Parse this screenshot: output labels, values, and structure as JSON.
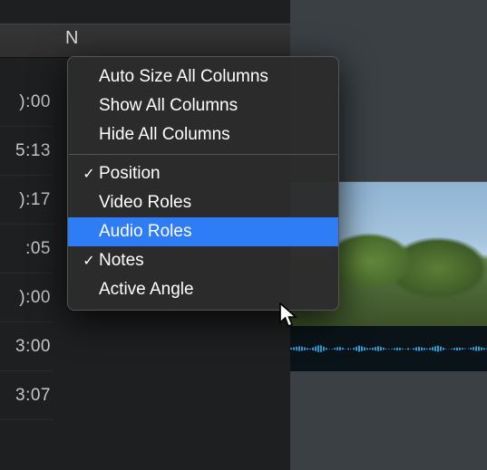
{
  "header": {
    "letter": "N"
  },
  "timecodes": [
    "):00",
    "5:13",
    "):17",
    ":05",
    "):00",
    "3:00",
    "3:07"
  ],
  "menu": {
    "top": [
      {
        "label": "Auto Size All Columns"
      },
      {
        "label": "Show All Columns"
      },
      {
        "label": "Hide All Columns"
      }
    ],
    "columns": [
      {
        "label": "Position",
        "checked": true,
        "highlight": false
      },
      {
        "label": "Video Roles",
        "checked": false,
        "highlight": false
      },
      {
        "label": "Audio Roles",
        "checked": false,
        "highlight": true
      },
      {
        "label": "Notes",
        "checked": true,
        "highlight": false
      },
      {
        "label": "Active Angle",
        "checked": false,
        "highlight": false
      }
    ]
  }
}
